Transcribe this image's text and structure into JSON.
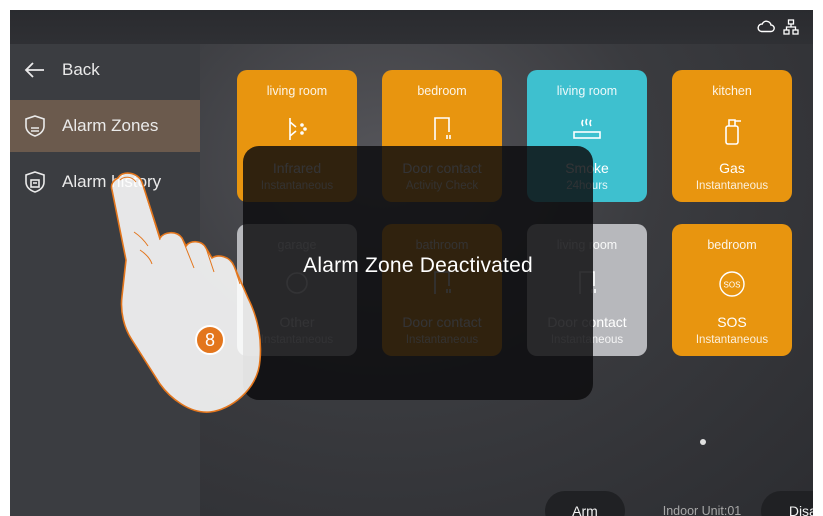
{
  "status_icons": [
    "cloud-icon",
    "network-icon"
  ],
  "sidebar": {
    "back_label": "Back",
    "items": [
      {
        "label": "Alarm Zones",
        "icon": "shield-icon",
        "active": true
      },
      {
        "label": "Alarm history",
        "icon": "history-shield-icon",
        "active": false
      }
    ]
  },
  "zones": [
    {
      "room": "living room",
      "type": "Infrared",
      "mode": "Instantaneous",
      "icon": "infrared-icon",
      "color": "#e8950f"
    },
    {
      "room": "bedroom",
      "type": "Door contact",
      "mode": "Activity Check",
      "icon": "door-icon",
      "color": "#e8950f"
    },
    {
      "room": "living room",
      "type": "Smoke",
      "mode": "24hours",
      "icon": "smoke-icon",
      "color": "#3ec0cf"
    },
    {
      "room": "kitchen",
      "type": "Gas",
      "mode": "Instantaneous",
      "icon": "gas-icon",
      "color": "#e8950f"
    },
    {
      "room": "garage",
      "type": "Other",
      "mode": "Instantaneous",
      "icon": "other-icon",
      "color": "#b7b8bc"
    },
    {
      "room": "bathroom",
      "type": "Door contact",
      "mode": "Instantaneous",
      "icon": "door-icon",
      "color": "#e8950f"
    },
    {
      "room": "living room",
      "type": "Door contact",
      "mode": "Instantaneous",
      "icon": "door-icon",
      "color": "#b7b8bc"
    },
    {
      "room": "bedroom",
      "type": "SOS",
      "mode": "Instantaneous",
      "icon": "sos-icon",
      "color": "#e8950f"
    }
  ],
  "overlay": {
    "message": "Alarm Zone Deactivated"
  },
  "bottom": {
    "arm_label": "Arm",
    "unit_label": "Indoor Unit:01",
    "disarm_label": "Disarm"
  },
  "step_badge": "8"
}
